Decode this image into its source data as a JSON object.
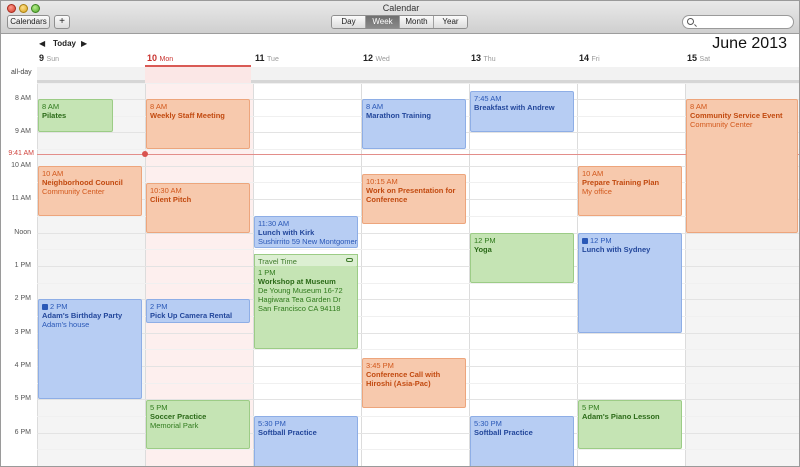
{
  "window": {
    "title": "Calendar"
  },
  "toolbar": {
    "calendars_label": "Calendars",
    "add_label": "+",
    "views": [
      {
        "label": "Day",
        "active": false
      },
      {
        "label": "Week",
        "active": true
      },
      {
        "label": "Month",
        "active": false
      },
      {
        "label": "Year",
        "active": false
      }
    ],
    "search_placeholder": ""
  },
  "nav": {
    "prev": "◀",
    "today": "Today",
    "next": "▶"
  },
  "month_title": "June 2013",
  "days": [
    {
      "num": "9",
      "name": "Sun"
    },
    {
      "num": "10",
      "name": "Mon"
    },
    {
      "num": "11",
      "name": "Tue"
    },
    {
      "num": "12",
      "name": "Wed"
    },
    {
      "num": "13",
      "name": "Thu"
    },
    {
      "num": "14",
      "name": "Fri"
    },
    {
      "num": "15",
      "name": "Sat"
    }
  ],
  "allday_label": "all-day",
  "hours": [
    "8 AM",
    "9 AM",
    "10 AM",
    "11 AM",
    "Noon",
    "1 PM",
    "2 PM",
    "3 PM",
    "4 PM",
    "5 PM",
    "6 PM"
  ],
  "now_label": "9:41 AM",
  "events": {
    "sun_pilates": {
      "time": "8 AM",
      "name": "Pilates"
    },
    "sun_council": {
      "time": "10 AM",
      "name": "Neighborhood Council",
      "location": "Community Center"
    },
    "sun_birthday": {
      "time": "2 PM",
      "name": "Adam's Birthday Party",
      "location": "Adam's house"
    },
    "mon_staff": {
      "time": "8 AM",
      "name": "Weekly Staff Meeting"
    },
    "mon_pitch": {
      "time": "10:30 AM",
      "name": "Client Pitch"
    },
    "mon_camera": {
      "time": "2 PM",
      "name": "Pick Up Camera Rental"
    },
    "mon_soccer": {
      "time": "5 PM",
      "name": "Soccer Practice",
      "location": "Memorial Park"
    },
    "tue_lunch": {
      "time": "11:30 AM",
      "name": "Lunch with Kirk",
      "location": "Sushirrito 59 New Montgomery..."
    },
    "tue_travel": {
      "label": "Travel Time"
    },
    "tue_workshop": {
      "time": "1 PM",
      "name": "Workshop at Museum",
      "location": "De Young Museum 16-72 Hagiwara Tea Garden Dr San Francisco CA 94118"
    },
    "tue_softball": {
      "time": "5:30 PM",
      "name": "Softball Practice"
    },
    "wed_marathon": {
      "time": "8 AM",
      "name": "Marathon Training"
    },
    "wed_presentation": {
      "time": "10:15 AM",
      "name": "Work on Presentation for Conference"
    },
    "wed_call": {
      "time": "3:45 PM",
      "name": "Conference Call with Hiroshi (Asia-Pac)"
    },
    "thu_breakfast": {
      "time": "7:45 AM",
      "name": "Breakfast with Andrew"
    },
    "thu_yoga": {
      "time": "12 PM",
      "name": "Yoga"
    },
    "thu_softball": {
      "time": "5:30 PM",
      "name": "Softball Practice"
    },
    "fri_training": {
      "time": "10 AM",
      "name": "Prepare Training Plan",
      "location": "My office"
    },
    "fri_lunch": {
      "time": "12 PM",
      "name": "Lunch with Sydney"
    },
    "fri_piano": {
      "time": "5 PM",
      "name": "Adam's Piano Lesson"
    },
    "sat_service": {
      "time": "8 AM",
      "name": "Community Service Event",
      "location": "Community Center"
    }
  },
  "colors": {
    "green": "#c5e4b4",
    "orange": "#f7c9ad",
    "blue": "#b7cdf3",
    "today_red": "#c9322e"
  }
}
